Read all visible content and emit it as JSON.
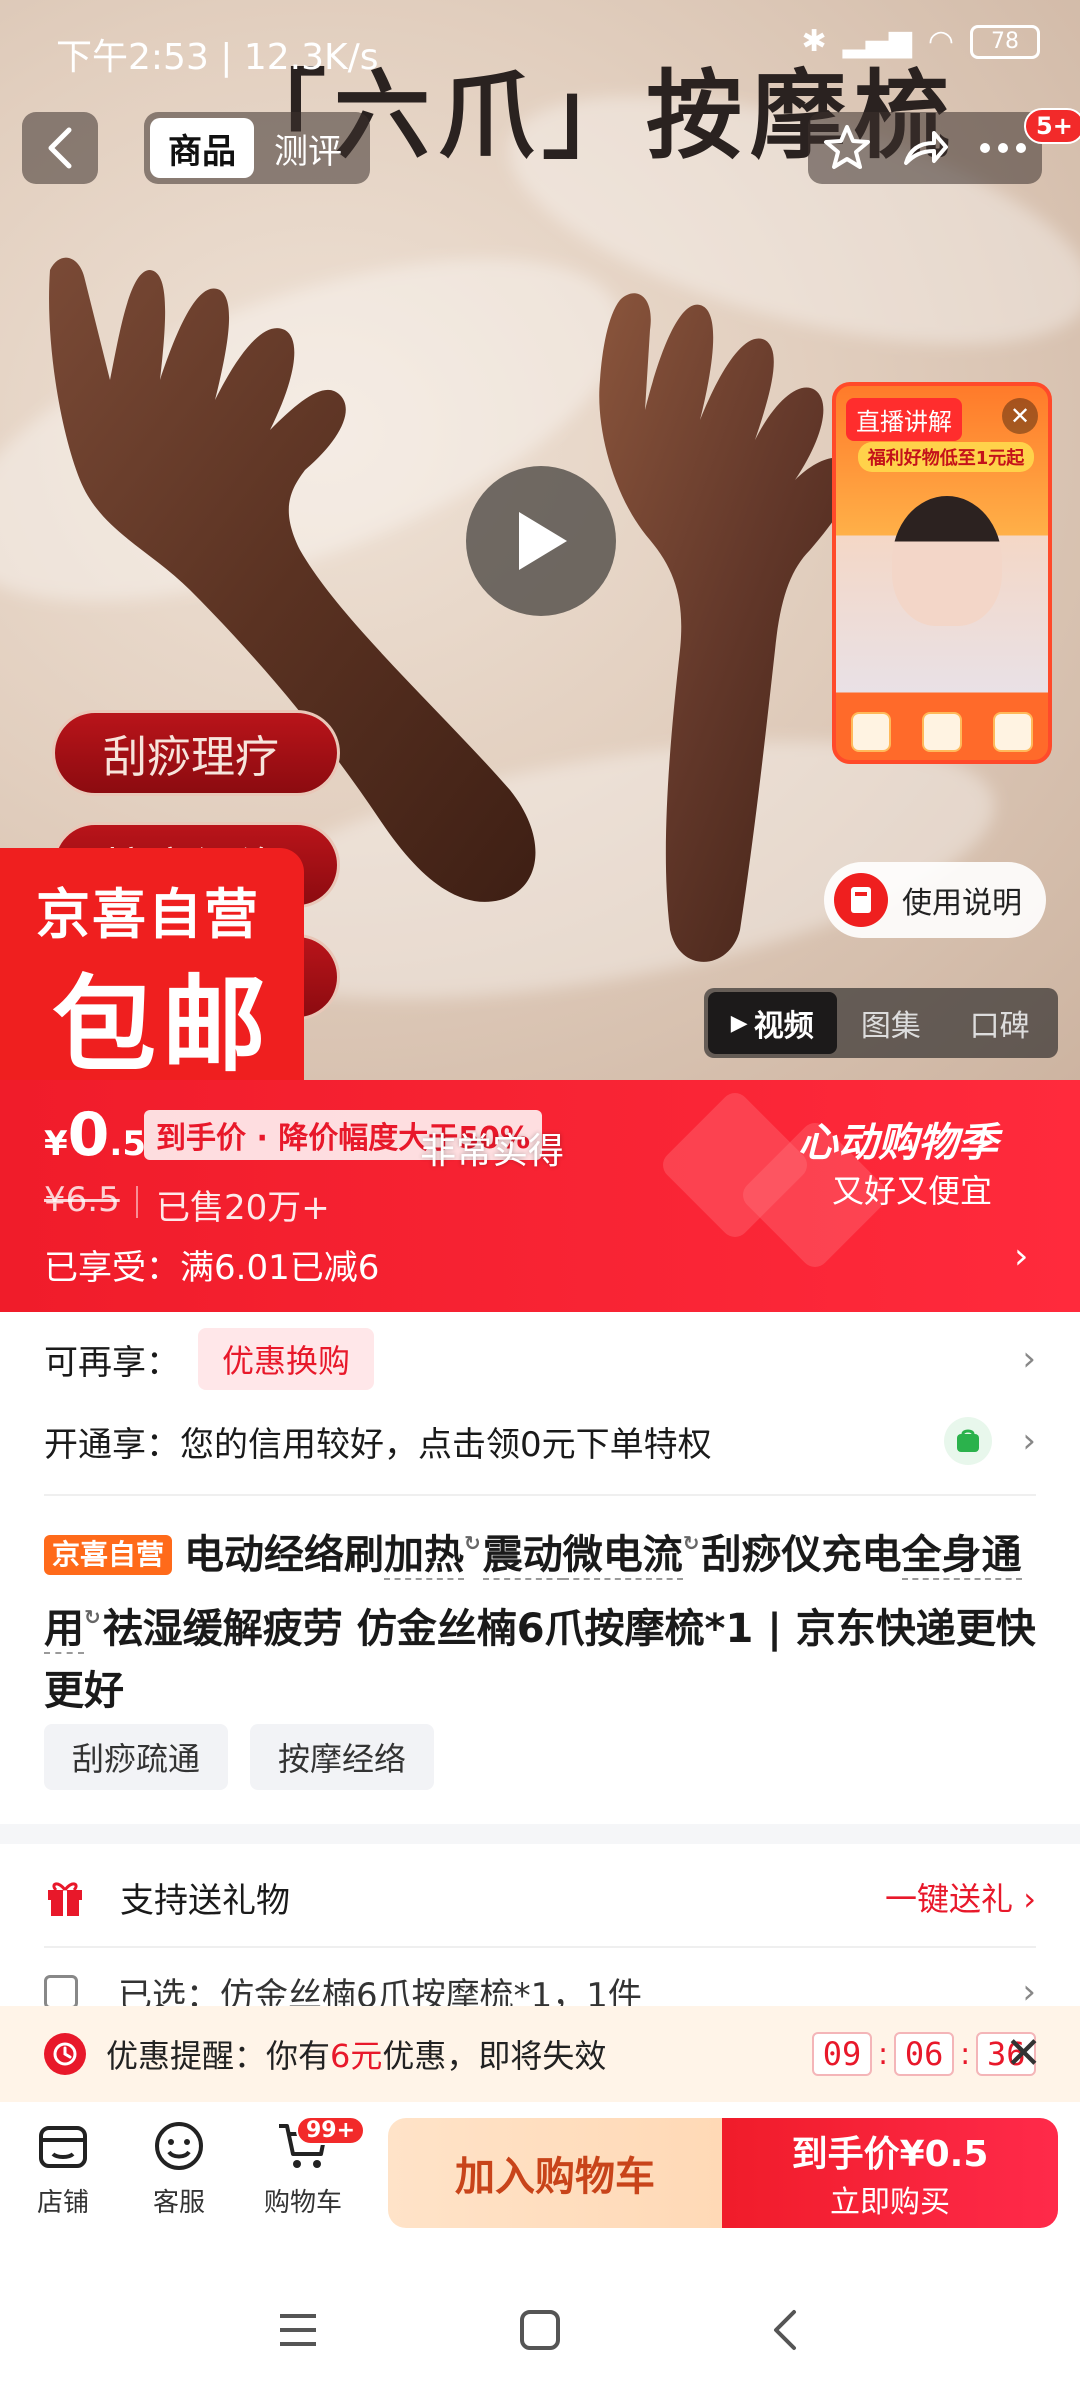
{
  "status_bar": {
    "time_speed": "下午2:53 | 12.3K/s",
    "battery": "78"
  },
  "nav": {
    "tab_active": "商品",
    "tab_inactive": "测评",
    "badge": "5+"
  },
  "hero": {
    "headline": "「六爪」按摩梳",
    "pills": [
      "刮痧理疗",
      "按摩经络",
      ""
    ],
    "live_tag": "直播讲解",
    "live_banner": "福利好物低至1元起",
    "badge_line1": "京喜自营",
    "badge_line2": "包邮",
    "manual": "使用说明",
    "media_tabs": [
      "视频",
      "图集",
      "口碑"
    ]
  },
  "price": {
    "currency": "¥",
    "integer": "0",
    "decimal": ".5",
    "tag": "到手价 · 降价幅度大于50%",
    "overlay": "非常实得",
    "original": "¥6.5",
    "sold": "已售20万+",
    "enjoyed": "已享受：满6.01已减6",
    "event_title": "心动购物季",
    "event_sub": "又好又便宜"
  },
  "more": {
    "label": "可再享：",
    "tag": "优惠换购"
  },
  "credit": {
    "text": "开通享：您的信用较好，点击领0元下单特权"
  },
  "title": {
    "badge": "京喜自营",
    "p1": "电动经络刷",
    "p2": "加热",
    "p3": "震动",
    "p4": "微电流",
    "p5": "刮痧仪充电",
    "p6": "全身通用",
    "p7": "祛湿缓解疲劳 仿金丝楠6爪按摩梳*1 | 京东快递更快更好"
  },
  "tags": [
    "刮痧疏通",
    "按摩经络"
  ],
  "gift": {
    "label": "支持送礼物",
    "action": "一键送礼"
  },
  "selected": {
    "text": "已选：仿金丝楠6爪按摩梳*1，1件"
  },
  "reminder": {
    "prefix": "优惠提醒：你有",
    "amount": "6元",
    "suffix": "优惠，即将失效",
    "hh": "09",
    "mm": "06",
    "ss": "36"
  },
  "bottom": {
    "shop": "店铺",
    "service": "客服",
    "cart": "购物车",
    "cart_badge": "99+",
    "add_cart": "加入购物车",
    "buy_line1": "到手价¥0.5",
    "buy_line2": "立即购买"
  },
  "colors": {
    "brand_red": "#f01c2a",
    "accent_orange": "#ff6a1a",
    "cream": "#ffe3c8"
  }
}
